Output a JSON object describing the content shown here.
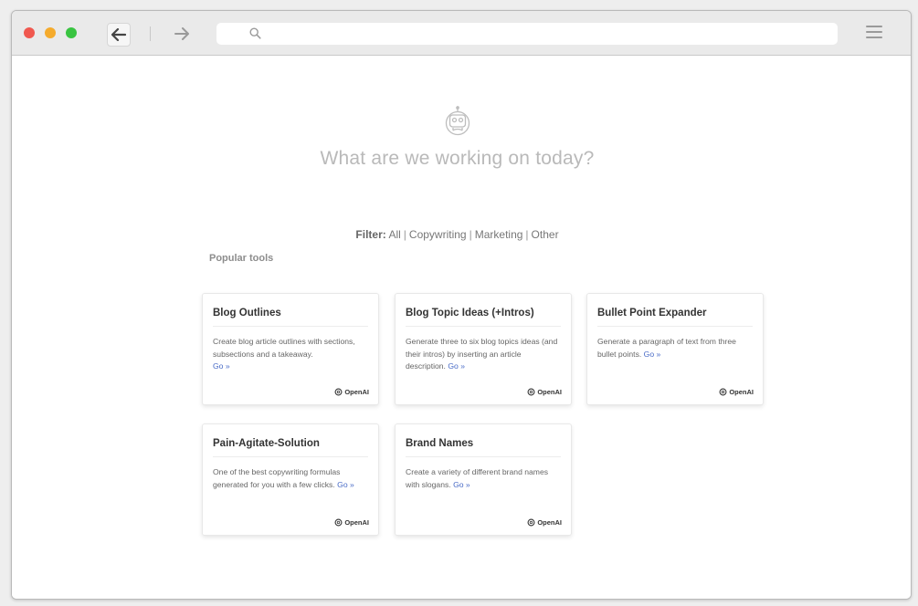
{
  "window": {
    "traffic_lights": [
      "red",
      "yellow",
      "green"
    ],
    "address": {
      "value": ""
    }
  },
  "main": {
    "headline": "What are we working on today?",
    "filter": {
      "label": "Filter:",
      "options": [
        "All",
        "Copywriting",
        "Marketing",
        "Other"
      ]
    },
    "section_title": "Popular tools",
    "cards": [
      {
        "title": "Blog Outlines",
        "desc": "Create blog article outlines with sections, subsections and a takeaway.",
        "link": "Go »",
        "provider": "OpenAI"
      },
      {
        "title": "Blog Topic Ideas (+Intros)",
        "desc": "Generate three to six blog topics ideas (and their intros) by inserting an article description.",
        "link": "Go »",
        "provider": "OpenAI"
      },
      {
        "title": "Bullet Point Expander",
        "desc": "Generate a paragraph of text from three bullet points.",
        "link": "Go »",
        "provider": "OpenAI"
      },
      {
        "title": "Pain-Agitate-Solution",
        "desc": "One of the best copywriting formulas generated for you with a few clicks.",
        "link": "Go »",
        "provider": "OpenAI"
      },
      {
        "title": "Brand Names",
        "desc": "Create a variety of different brand names with slogans.",
        "link": "Go »",
        "provider": "OpenAI"
      }
    ]
  },
  "colors": {
    "link": "#4a6cc7",
    "headline": "#b9b9b9",
    "traffic_red": "#f0584f",
    "traffic_yellow": "#f5ab2d",
    "traffic_green": "#39c441"
  },
  "icons": [
    "back-arrow-icon",
    "forward-arrow-icon",
    "search-icon",
    "hamburger-menu-icon",
    "robot-logo-icon",
    "openai-icon"
  ]
}
